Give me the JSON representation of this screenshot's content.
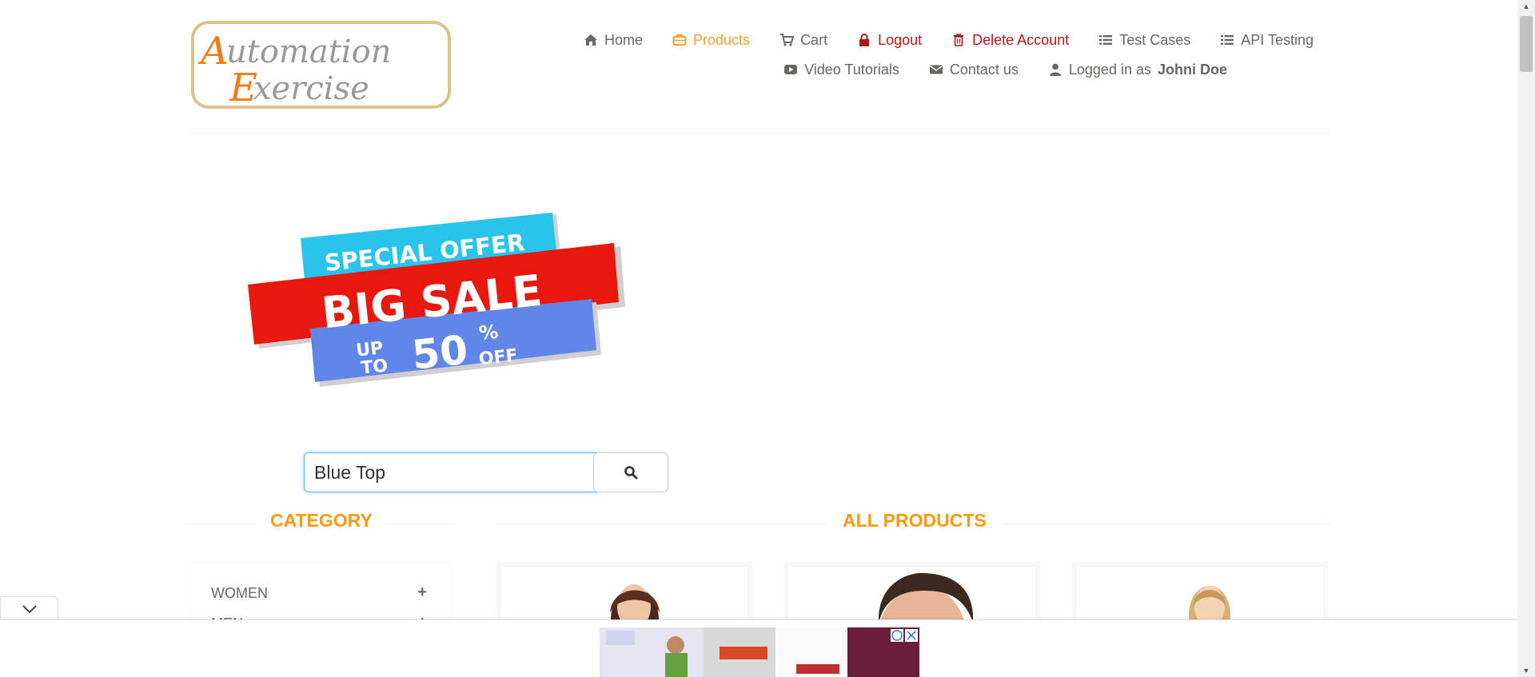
{
  "logo": {
    "line1": "Automation",
    "line2": "Exercise"
  },
  "nav": {
    "row1": [
      {
        "icon": "home-icon",
        "label": "Home"
      },
      {
        "icon": "briefcase-icon",
        "label": "Products"
      },
      {
        "icon": "cart-icon",
        "label": "Cart"
      },
      {
        "icon": "lock-icon",
        "label": "Logout"
      },
      {
        "icon": "trash-icon",
        "label": "Delete Account"
      },
      {
        "icon": "list-icon",
        "label": "Test Cases"
      },
      {
        "icon": "list-icon",
        "label": "API Testing"
      }
    ],
    "row2": [
      {
        "icon": "youtube-icon",
        "label": "Video Tutorials"
      },
      {
        "icon": "envelope-icon",
        "label": "Contact us"
      },
      {
        "icon": "user-icon",
        "label": "Logged in as",
        "user": "Johni Doe"
      }
    ]
  },
  "banner": {
    "line1": "SPECIAL OFFER",
    "line2": "BIG SALE",
    "up": "UP",
    "to": "TO",
    "percent": "50",
    "pct_sign": "%",
    "off": "OFF"
  },
  "search": {
    "value": "Blue Top"
  },
  "category": {
    "title": "CATEGORY",
    "items": [
      {
        "label": "WOMEN"
      },
      {
        "label": "MEN"
      }
    ]
  },
  "products": {
    "title": "ALL PRODUCTS"
  },
  "colors": {
    "accent": "#FE980F",
    "active_nav": "#F0A030",
    "danger": "#B01818"
  }
}
